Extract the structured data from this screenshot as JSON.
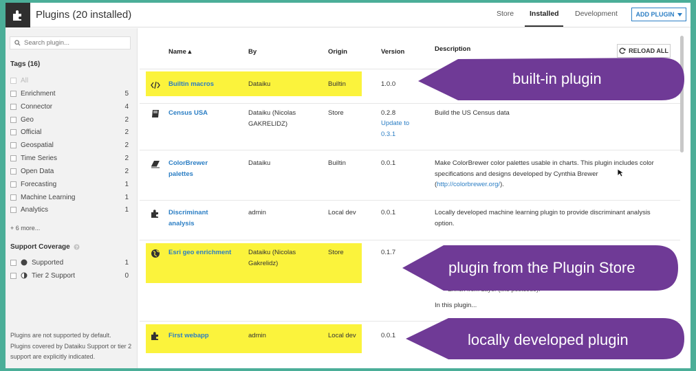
{
  "header": {
    "title": "Plugins (20 installed)",
    "tabs": [
      {
        "label": "Store"
      },
      {
        "label": "Installed"
      },
      {
        "label": "Development"
      }
    ],
    "add_plugin_label": "ADD PLUGIN"
  },
  "sidebar": {
    "search_placeholder": "Search plugin...",
    "tags_heading": "Tags (16)",
    "tags": [
      {
        "label": "All",
        "count": ""
      },
      {
        "label": "Enrichment",
        "count": "5"
      },
      {
        "label": "Connector",
        "count": "4"
      },
      {
        "label": "Geo",
        "count": "2"
      },
      {
        "label": "Official",
        "count": "2"
      },
      {
        "label": "Geospatial",
        "count": "2"
      },
      {
        "label": "Time Series",
        "count": "2"
      },
      {
        "label": "Open Data",
        "count": "2"
      },
      {
        "label": "Forecasting",
        "count": "1"
      },
      {
        "label": "Machine Learning",
        "count": "1"
      },
      {
        "label": "Analytics",
        "count": "1"
      }
    ],
    "more_tags": "+ 6 more...",
    "support_heading": "Support Coverage",
    "support": [
      {
        "label": "Supported",
        "count": "1"
      },
      {
        "label": "Tier 2 Support",
        "count": "0"
      }
    ],
    "note": "Plugins are not supported by default. Plugins covered by Dataiku Support or tier 2 support are explicitly indicated."
  },
  "table": {
    "columns": {
      "name": "Name ▴",
      "by": "By",
      "origin": "Origin",
      "version": "Version",
      "description": "Description"
    },
    "reload_label": "RELOAD ALL",
    "rows": [
      {
        "icon": "code-icon",
        "name": "Builtin macros",
        "by": "Dataiku",
        "origin": "Builtin",
        "version": "1.0.0",
        "update": "",
        "description": ""
      },
      {
        "icon": "book-icon",
        "name": "Census USA",
        "by": "Dataiku (Nicolas GAKRELIDZ)",
        "origin": "Store",
        "version": "0.2.8",
        "update": "Update to 0.3.1",
        "description": "Build the US Census data"
      },
      {
        "icon": "eraser-icon",
        "name": "ColorBrewer palettes",
        "by": "Dataiku",
        "origin": "Builtin",
        "version": "0.0.1",
        "update": "",
        "description": "Make ColorBrewer color palettes usable in charts. This plugin includes color specifications and designs developed by Cynthia Brewer (",
        "description_link": "http://colorbrewer.org/",
        "description_end": ")."
      },
      {
        "icon": "puzzle-icon",
        "name": "Discriminant analysis",
        "by": "admin",
        "origin": "Local dev",
        "version": "0.0.1",
        "update": "",
        "description": "Locally developed machine learning plugin to provide discriminant analysis option."
      },
      {
        "icon": "globe-icon",
        "name": "Esri geo enrichment",
        "by": "Dataiku (Nicolas Gakrelidz)",
        "origin": "Store",
        "version": "0.1.7",
        "update": "",
        "description": "Enrich from Layer (like postcode).",
        "description_more": "In this plugin..."
      },
      {
        "icon": "puzzle-icon",
        "name": "First webapp",
        "by": "admin",
        "origin": "Local dev",
        "version": "0.0.1",
        "update": "",
        "description": ""
      }
    ]
  },
  "callouts": [
    {
      "text": "built-in plugin"
    },
    {
      "text": "plugin from the Plugin Store"
    },
    {
      "text": "locally developed plugin"
    }
  ],
  "colors": {
    "accent": "#2b7ec4",
    "highlight": "#fbf33c",
    "callout": "#6f3a96",
    "frame": "#4bae98"
  }
}
